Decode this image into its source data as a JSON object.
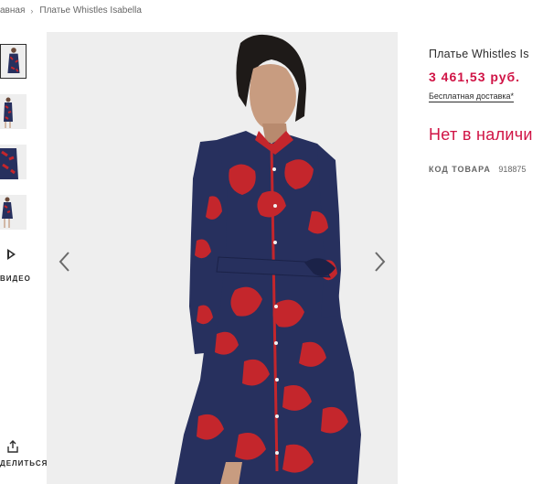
{
  "breadcrumb": {
    "home": "авная",
    "separator": "›",
    "current": "Платье Whistles Isabella"
  },
  "gallery": {
    "thumbnails": [
      "thumb-1",
      "thumb-2",
      "thumb-3",
      "thumb-4"
    ],
    "video_label": "ВИДЕО",
    "share_label": "ДЕЛИТЬСЯ"
  },
  "product": {
    "title": "Платье Whistles Is",
    "price": "3 461,53 руб.",
    "delivery": "Бесплатная доставка*",
    "stock_status": "Нет в наличи",
    "code_label": "КОД ТОВАРА",
    "code_value": "918875"
  },
  "colors": {
    "accent": "#d01345",
    "dress_navy": "#27305e",
    "dress_red": "#c4262c",
    "background": "#eeeeee"
  },
  "icons": {
    "prev": "chevron-left-icon",
    "next": "chevron-right-icon",
    "video": "play-icon",
    "share": "share-icon"
  }
}
